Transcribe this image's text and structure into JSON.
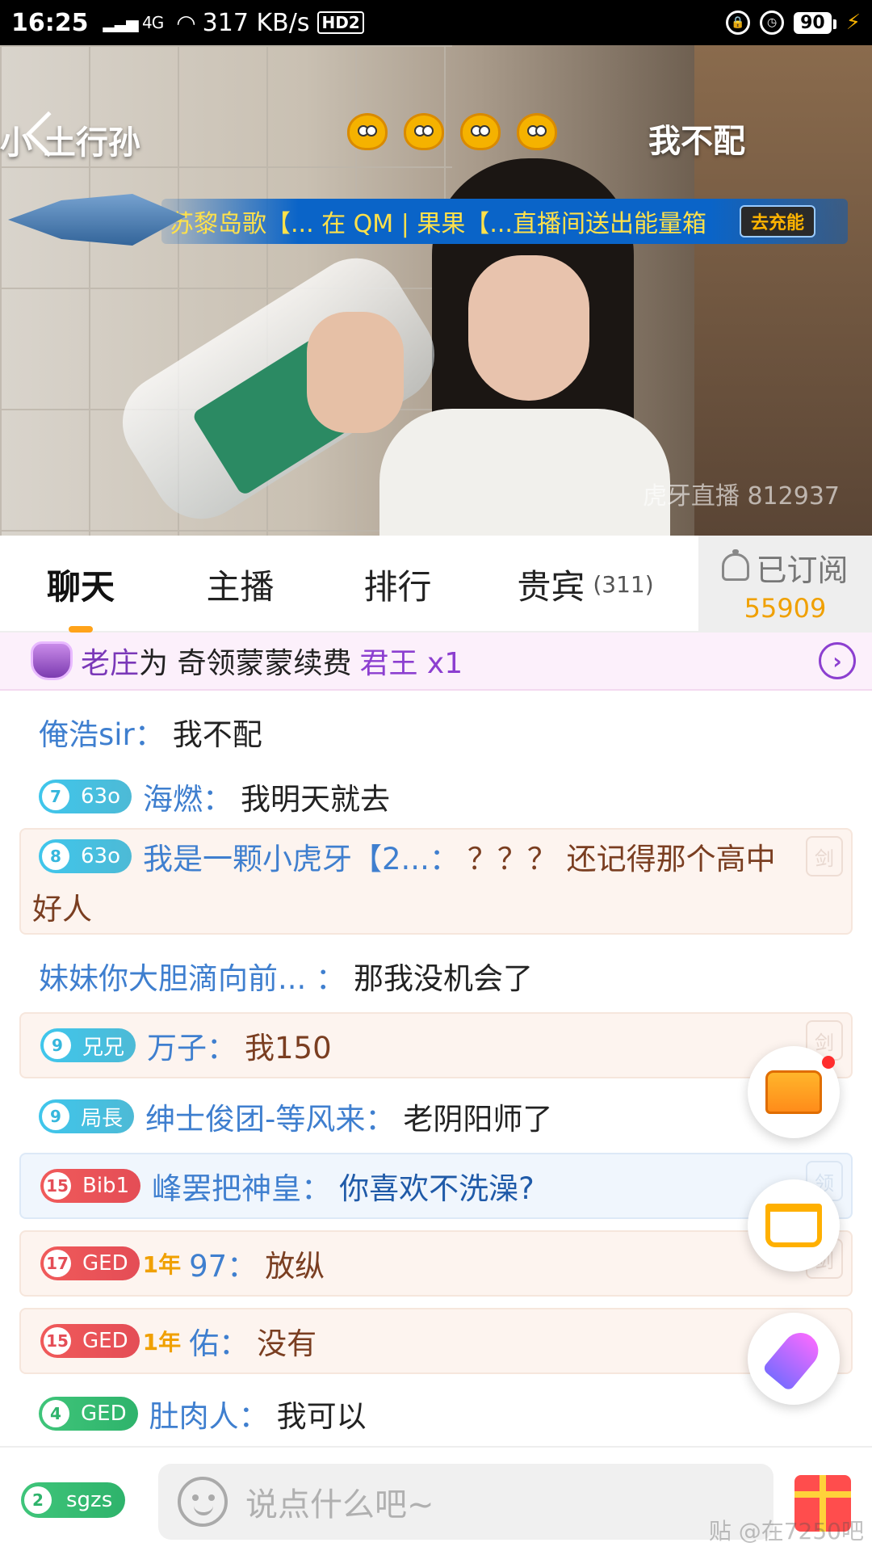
{
  "status_bar": {
    "time": "16:25",
    "signal": "4G",
    "speed": "317 KB/s",
    "hd": "HD2",
    "battery": "90"
  },
  "video": {
    "streamer_name": "小 土行孙",
    "top_right_text": "我不配",
    "banner_text": "苏黎岛歌【... 在 QM | 果果【...直播间送出能量箱",
    "banner_button": "去充能",
    "watermark": "虎牙直播 812937"
  },
  "tabs": [
    {
      "label": "聊天"
    },
    {
      "label": "主播"
    },
    {
      "label": "排行"
    },
    {
      "label": "贵宾",
      "count": "(311)"
    }
  ],
  "subscribe": {
    "label": "已订阅",
    "count": "55909"
  },
  "notice": {
    "user": "老庄",
    "middle": "为 奇领蒙蒙续费",
    "item": "君王 x1"
  },
  "chat": [
    {
      "name": "俺浩sir：",
      "text": "我不配"
    },
    {
      "badge_level": "7",
      "badge_label": "63o",
      "name": "海燃：",
      "text": "我明天就去"
    },
    {
      "badge_level": "8",
      "badge_label": "63o",
      "name": "我是一颗小虎牙【2...：",
      "text": "？？？ 还记得那个高中",
      "text2": "好人",
      "side": "剑"
    },
    {
      "name": "妹妹你大胆滴向前...  ：",
      "text": "那我没机会了"
    },
    {
      "badge_level": "9",
      "badge_label": "兄兄",
      "name": "万子：",
      "text": "我150",
      "side": "剑"
    },
    {
      "badge_level": "9",
      "badge_label": "局長",
      "name": "绅士俊团-等风来：",
      "text": "老阴阳师了"
    },
    {
      "badge_level": "15",
      "badge_label": "Bib1",
      "name": "峰罢把神皇：",
      "text": "你喜欢不洗澡?",
      "side": "领"
    },
    {
      "badge_level": "17",
      "badge_label": "GED",
      "year": "1年",
      "name": "97：",
      "text": "放纵",
      "side": "剑"
    },
    {
      "badge_level": "15",
      "badge_label": "GED",
      "year": "1年",
      "name": "佑：",
      "text": "没有"
    },
    {
      "badge_level": "4",
      "badge_label": "GED",
      "name": "肚肉人：",
      "text": "我可以"
    }
  ],
  "input": {
    "user_badge_level": "2",
    "user_badge_label": "sgzs",
    "placeholder": "说点什么吧~",
    "watermark": "贴 @在7250吧"
  }
}
